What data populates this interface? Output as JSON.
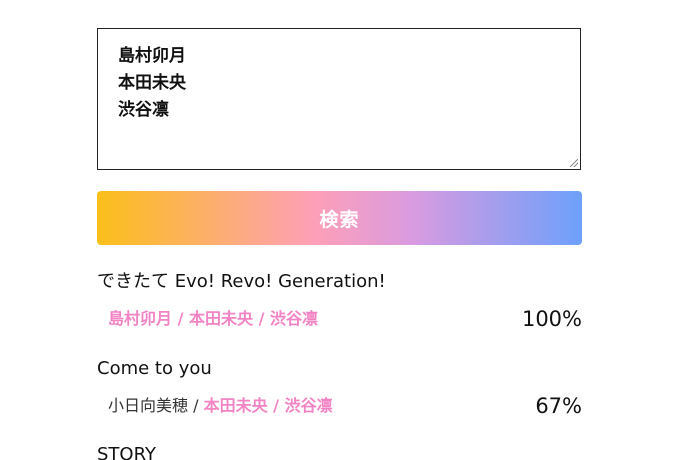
{
  "query": {
    "lines": [
      "島村卯月",
      "本田未央",
      "渋谷凛"
    ]
  },
  "search_button": {
    "label": "検索"
  },
  "results": [
    {
      "title": "できたて Evo! Revo! Generation!",
      "members": [
        {
          "name": "島村卯月",
          "matched": true
        },
        {
          "name": "本田未央",
          "matched": true
        },
        {
          "name": "渋谷凛",
          "matched": true
        }
      ],
      "separator": " / ",
      "match_percent": "100%"
    },
    {
      "title": "Come to you",
      "members": [
        {
          "name": "小日向美穂",
          "matched": false
        },
        {
          "name": "本田未央",
          "matched": true
        },
        {
          "name": "渋谷凛",
          "matched": true
        }
      ],
      "separator": " / ",
      "match_percent": "67%"
    },
    {
      "title": "STORY"
    }
  ],
  "colors": {
    "matched_member": "#f283c4",
    "gradient": [
      "#fbbf1a",
      "#fd9fb8",
      "#d99be0",
      "#6da0fb"
    ]
  }
}
